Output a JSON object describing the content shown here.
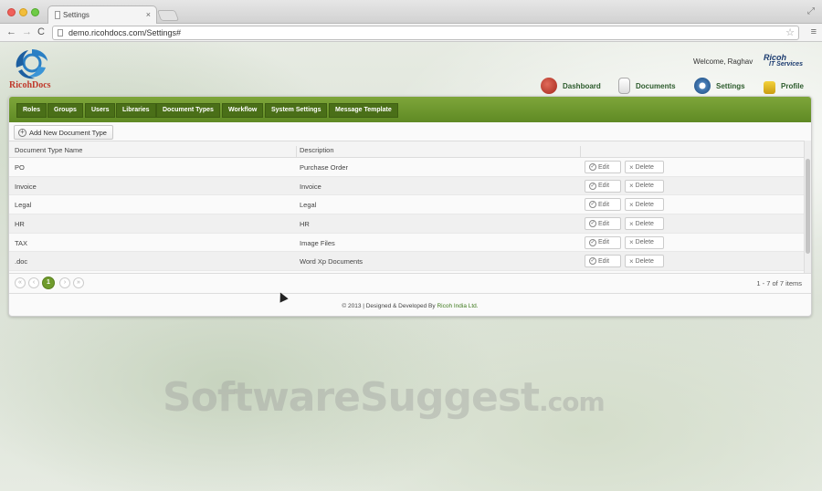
{
  "browser": {
    "tab_title": "Settings",
    "tab_close": "×",
    "url": "demo.ricohdocs.com/Settings#",
    "nav_back": "←",
    "nav_forward": "→",
    "nav_reload": "C",
    "star": "☆",
    "menu": "≡",
    "fullscreen": "⤢"
  },
  "header": {
    "logo_text": "RicohDocs",
    "welcome": "Welcome, Raghav",
    "brand_line1": "Ricoh",
    "brand_line2": "IT Services"
  },
  "top_nav": [
    {
      "label": "Dashboard",
      "icon": "dashboard-icon"
    },
    {
      "label": "Documents",
      "icon": "documents-icon"
    },
    {
      "label": "Settings",
      "icon": "settings-icon"
    },
    {
      "label": "Profile",
      "icon": "profile-icon"
    }
  ],
  "settings_tabs": [
    "Roles",
    "Groups",
    "Users",
    "Libraries",
    "Document Types",
    "Workflow",
    "System Settings",
    "Message Template"
  ],
  "add_button": "Add New Document Type",
  "table": {
    "columns": [
      "Document Type Name",
      "Description"
    ],
    "rows": [
      {
        "name": "PO",
        "description": "Purchase Order"
      },
      {
        "name": "Invoice",
        "description": "Invoice"
      },
      {
        "name": "Legal",
        "description": "Legal"
      },
      {
        "name": "HR",
        "description": "HR"
      },
      {
        "name": "TAX",
        "description": "Image Files"
      },
      {
        "name": ".doc",
        "description": "Word Xp Documents"
      }
    ],
    "edit_label": "Edit",
    "delete_label": "Delete"
  },
  "pager": {
    "first": "«",
    "prev": "‹",
    "current_page": "1",
    "next": "›",
    "last": "»",
    "info": "1 - 7 of 7 items"
  },
  "footer": {
    "text": "© 2013 | Designed & Developed By",
    "company": "Ricoh India Ltd."
  },
  "watermark": {
    "main": "SoftwareSuggest",
    "suffix": ".com"
  },
  "colors": {
    "accent_green": "#6f9b2c",
    "tab_dark_green": "#4a6f18",
    "logo_red": "#c0392b"
  }
}
